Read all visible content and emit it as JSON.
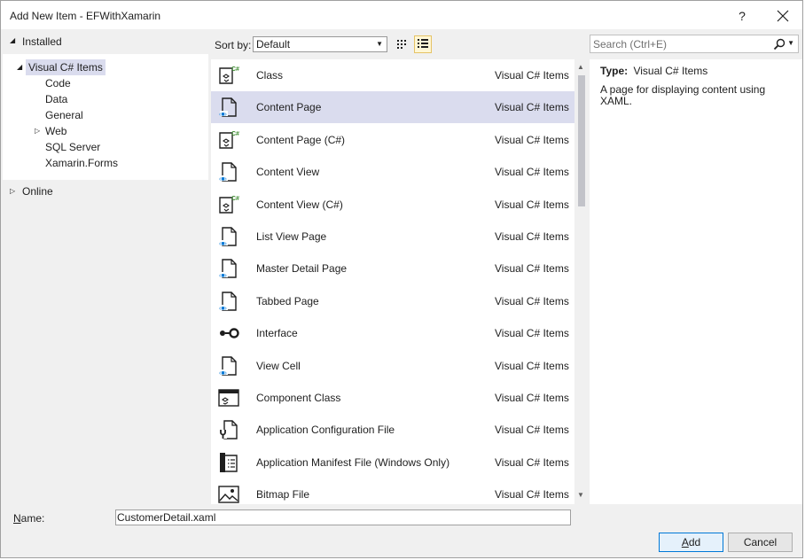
{
  "window": {
    "title": "Add New Item - EFWithXamarin",
    "help_label": "?",
    "close_label": "✕"
  },
  "left_pane": {
    "installed_label": "Installed",
    "tree": [
      {
        "label": "Visual C# Items",
        "level": 0,
        "expanded": true,
        "selected": true
      },
      {
        "label": "Code",
        "level": 1
      },
      {
        "label": "Data",
        "level": 1
      },
      {
        "label": "General",
        "level": 1
      },
      {
        "label": "Web",
        "level": 1,
        "collapsible": true
      },
      {
        "label": "SQL Server",
        "level": 1
      },
      {
        "label": "Xamarin.Forms",
        "level": 1
      }
    ],
    "online_label": "Online"
  },
  "toolbar": {
    "sort_label": "Sort by:",
    "sort_value": "Default",
    "view_mode": "list"
  },
  "items": [
    {
      "name": "Class",
      "category": "Visual C# Items",
      "icon": "csharp-class-icon"
    },
    {
      "name": "Content Page",
      "category": "Visual C# Items",
      "icon": "xaml-page-icon",
      "selected": true
    },
    {
      "name": "Content Page (C#)",
      "category": "Visual C# Items",
      "icon": "csharp-class-icon"
    },
    {
      "name": "Content View",
      "category": "Visual C# Items",
      "icon": "xaml-page-icon"
    },
    {
      "name": "Content View (C#)",
      "category": "Visual C# Items",
      "icon": "csharp-class-icon"
    },
    {
      "name": "List View Page",
      "category": "Visual C# Items",
      "icon": "xaml-page-icon"
    },
    {
      "name": "Master Detail Page",
      "category": "Visual C# Items",
      "icon": "xaml-page-icon"
    },
    {
      "name": "Tabbed Page",
      "category": "Visual C# Items",
      "icon": "xaml-page-icon"
    },
    {
      "name": "Interface",
      "category": "Visual C# Items",
      "icon": "interface-icon"
    },
    {
      "name": "View Cell",
      "category": "Visual C# Items",
      "icon": "xaml-page-icon"
    },
    {
      "name": "Component Class",
      "category": "Visual C# Items",
      "icon": "component-class-icon"
    },
    {
      "name": "Application Configuration File",
      "category": "Visual C# Items",
      "icon": "config-file-icon"
    },
    {
      "name": "Application Manifest File (Windows Only)",
      "category": "Visual C# Items",
      "icon": "manifest-file-icon"
    },
    {
      "name": "Bitmap File",
      "category": "Visual C# Items",
      "icon": "bitmap-file-icon"
    }
  ],
  "search": {
    "placeholder": "Search (Ctrl+E)"
  },
  "details": {
    "type_label": "Type:",
    "type_value": "Visual C# Items",
    "description": "A page for displaying content using XAML."
  },
  "name_field": {
    "label_accel": "N",
    "label_rest": "ame:",
    "value": "CustomerDetail.xaml"
  },
  "buttons": {
    "add_accel": "A",
    "add_rest": "dd",
    "cancel": "Cancel"
  },
  "colors": {
    "selection": "#dadcee",
    "accent": "#0078d7",
    "csharp_green": "#3a8a2d"
  }
}
